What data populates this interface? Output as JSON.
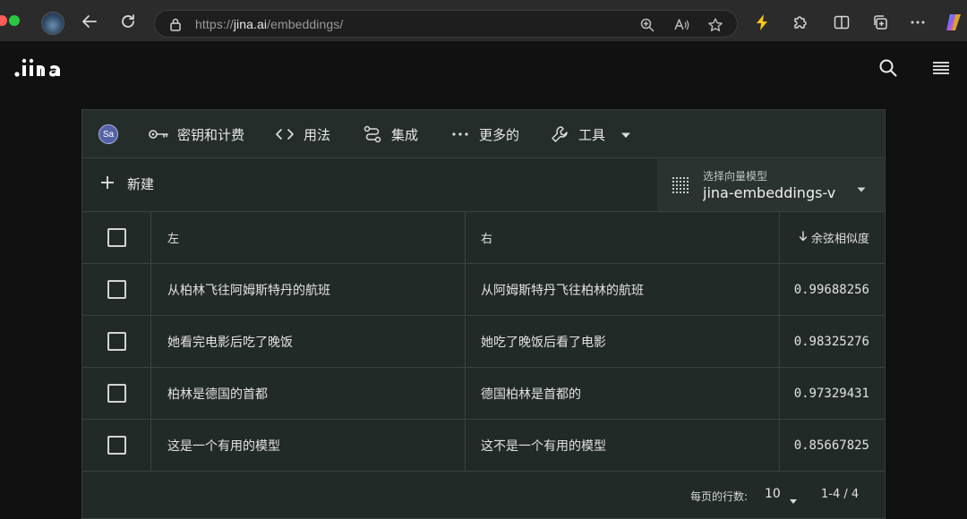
{
  "browser": {
    "url_prefix": "https://",
    "url_host": "jina.ai",
    "url_path": "/embeddings/"
  },
  "toolbar": {
    "avatar": "Sa",
    "items": [
      {
        "label": "密钥和计费",
        "icon": "key-icon"
      },
      {
        "label": "用法",
        "icon": "code-icon"
      },
      {
        "label": "集成",
        "icon": "route-icon"
      },
      {
        "label": "更多的",
        "icon": "more-horizontal-icon"
      },
      {
        "label": "工具",
        "icon": "wrench-icon"
      }
    ]
  },
  "actions": {
    "new_label": "新建"
  },
  "model_select": {
    "label": "选择向量模型",
    "value": "jina-embeddings-v"
  },
  "table": {
    "headers": {
      "left": "左",
      "right": "右",
      "score": "余弦相似度"
    },
    "rows": [
      {
        "left": "从柏林飞往阿姆斯特丹的航班",
        "right": "从阿姆斯特丹飞往柏林的航班",
        "score": "0.99688256"
      },
      {
        "left": "她看完电影后吃了晚饭",
        "right": "她吃了晚饭后看了电影",
        "score": "0.98325276"
      },
      {
        "left": "柏林是德国的首都",
        "right": "德国柏林是首都的",
        "score": "0.97329431"
      },
      {
        "left": "这是一个有用的模型",
        "right": "这不是一个有用的模型",
        "score": "0.85667825"
      }
    ]
  },
  "pagination": {
    "rows_per_page_label": "每页的行数:",
    "rows_per_page_value": "10",
    "range": "1-4 / 4"
  },
  "colors": {
    "accent": "#f5c518",
    "panel_bg": "#222a27"
  }
}
